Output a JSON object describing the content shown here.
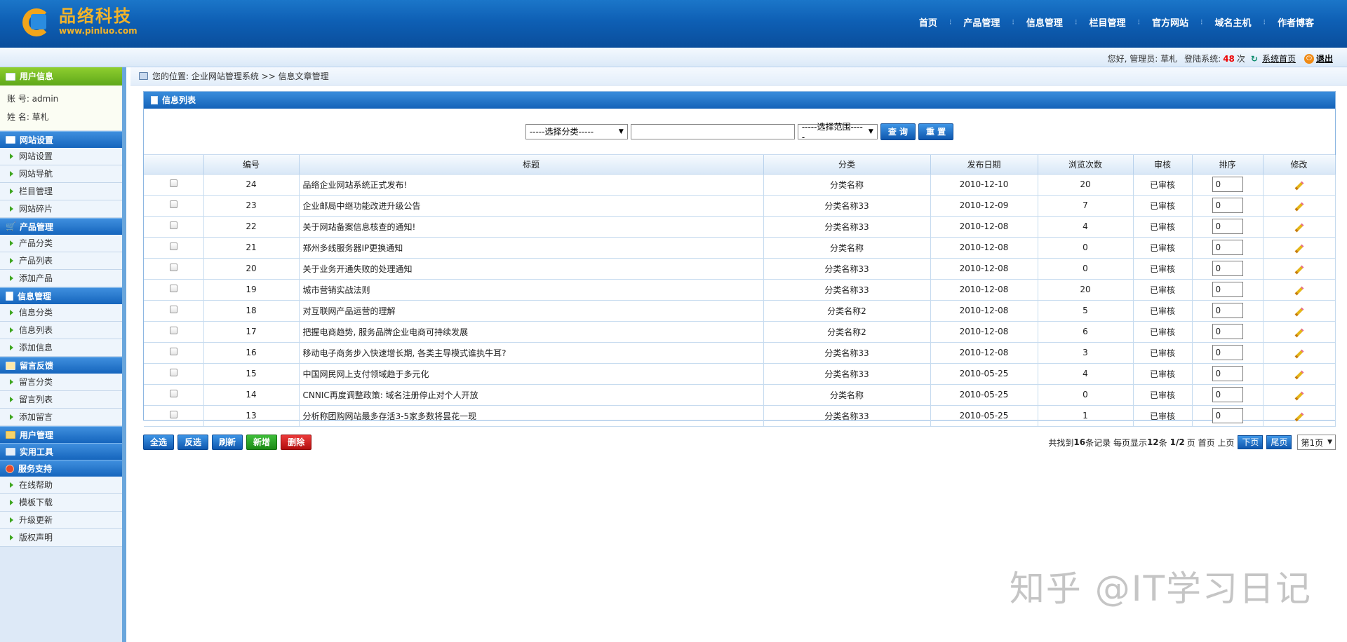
{
  "logo": {
    "cn": "品络科技",
    "en": "www.pinluo.com"
  },
  "topnav": [
    "首页",
    "产品管理",
    "信息管理",
    "栏目管理",
    "官方网站",
    "域名主机",
    "作者博客"
  ],
  "status": {
    "greeting": "您好, 管理员: 草札",
    "login_label": "登陆系统:",
    "login_count": "48",
    "login_unit": "次",
    "home_link": "系统首页",
    "logout": "退出"
  },
  "sidebar": {
    "user_head": "用户信息",
    "account": "账 号: admin",
    "name": "姓 名: 草札",
    "sections": [
      {
        "title": "网站设置",
        "icon": "window-icon",
        "items": [
          "网站设置",
          "网站导航",
          "栏目管理",
          "网站碎片"
        ]
      },
      {
        "title": "产品管理",
        "icon": "cart-icon",
        "items": [
          "产品分类",
          "产品列表",
          "添加产品"
        ]
      },
      {
        "title": "信息管理",
        "icon": "document-icon",
        "items": [
          "信息分类",
          "信息列表",
          "添加信息"
        ]
      },
      {
        "title": "留言反馈",
        "icon": "message-icon",
        "items": [
          "留言分类",
          "留言列表",
          "添加留言"
        ]
      },
      {
        "title": "用户管理",
        "icon": "folder-icon",
        "items": []
      },
      {
        "title": "实用工具",
        "icon": "tool-icon",
        "items": []
      },
      {
        "title": "服务支持",
        "icon": "help-icon",
        "items": [
          "在线帮助",
          "模板下载",
          "升级更新",
          "版权声明"
        ]
      }
    ]
  },
  "breadcrumb": "您的位置: 企业网站管理系统 >> 信息文章管理",
  "panel": {
    "title": "信息列表",
    "category_select": "-----选择分类-----",
    "scope_select": "-----选择范围-----",
    "search_button": "查 询",
    "reset_button": "重 置"
  },
  "table": {
    "headers": [
      "",
      "编号",
      "标题",
      "分类",
      "发布日期",
      "浏览次数",
      "审核",
      "排序",
      "修改"
    ],
    "rows": [
      {
        "id": "24",
        "title": "品络企业网站系统正式发布!",
        "category": "分类名称",
        "date": "2010-12-10",
        "views": "20",
        "status": "已审核",
        "sort": "0"
      },
      {
        "id": "23",
        "title": "企业邮局中继功能改进升级公告",
        "category": "分类名称33",
        "date": "2010-12-09",
        "views": "7",
        "status": "已审核",
        "sort": "0"
      },
      {
        "id": "22",
        "title": "关于网站备案信息核查的通知!",
        "category": "分类名称33",
        "date": "2010-12-08",
        "views": "4",
        "status": "已审核",
        "sort": "0"
      },
      {
        "id": "21",
        "title": "郑州多线服务器IP更换通知",
        "category": "分类名称",
        "date": "2010-12-08",
        "views": "0",
        "status": "已审核",
        "sort": "0"
      },
      {
        "id": "20",
        "title": "关于业务开通失败的处理通知",
        "category": "分类名称33",
        "date": "2010-12-08",
        "views": "0",
        "status": "已审核",
        "sort": "0"
      },
      {
        "id": "19",
        "title": "城市营销实战法则",
        "category": "分类名称33",
        "date": "2010-12-08",
        "views": "20",
        "status": "已审核",
        "sort": "0"
      },
      {
        "id": "18",
        "title": "对互联网产品运营的理解",
        "category": "分类名称2",
        "date": "2010-12-08",
        "views": "5",
        "status": "已审核",
        "sort": "0"
      },
      {
        "id": "17",
        "title": "把握电商趋势, 服务品牌企业电商可持续发展",
        "category": "分类名称2",
        "date": "2010-12-08",
        "views": "6",
        "status": "已审核",
        "sort": "0"
      },
      {
        "id": "16",
        "title": "移动电子商务步入快速增长期, 各类主导模式谁执牛耳?",
        "category": "分类名称33",
        "date": "2010-12-08",
        "views": "3",
        "status": "已审核",
        "sort": "0"
      },
      {
        "id": "15",
        "title": "中国网民网上支付领域趋于多元化",
        "category": "分类名称33",
        "date": "2010-05-25",
        "views": "4",
        "status": "已审核",
        "sort": "0"
      },
      {
        "id": "14",
        "title": "CNNIC再度调整政策: 域名注册停止对个人开放",
        "category": "分类名称",
        "date": "2010-05-25",
        "views": "0",
        "status": "已审核",
        "sort": "0"
      },
      {
        "id": "13",
        "title": "分析称团购网站最多存活3-5家多数将昙花一现",
        "category": "分类名称33",
        "date": "2010-05-25",
        "views": "1",
        "status": "已审核",
        "sort": "0"
      }
    ]
  },
  "actions": [
    "全选",
    "反选",
    "刷新",
    "新增",
    "删除"
  ],
  "pager": {
    "text1": "共找到",
    "total": "16",
    "text2": "条记录 每页显示",
    "per_page": "12",
    "text3": "条",
    "page": "1/2",
    "text4": "页 首页 上页",
    "next": "下页",
    "last": "尾页",
    "select": "第1页"
  },
  "watermark": "知乎 @IT学习日记"
}
